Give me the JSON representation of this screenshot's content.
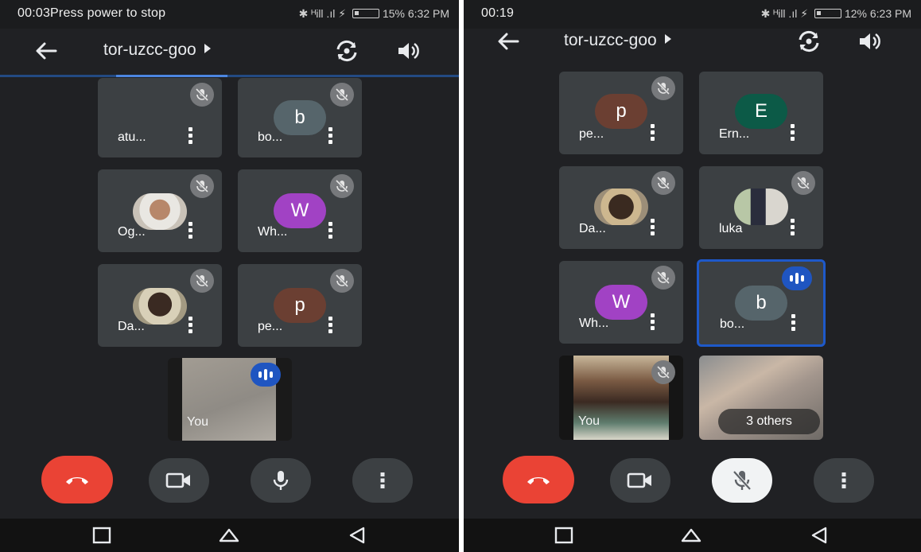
{
  "left": {
    "status": {
      "timer": "00:03",
      "message": "Press power to stop",
      "signal": "✱ ᴴill .ıl ⚡",
      "battery": "15%",
      "time": "6:32 PM"
    },
    "meeting_title": "tor-uzcc-goo",
    "tiles": [
      {
        "name": "atu...",
        "avatar_letter": "",
        "muted": true
      },
      {
        "name": "bo...",
        "avatar_letter": "b",
        "avatar_color": "#56656b",
        "muted": true
      },
      {
        "name": "Og...",
        "avatar_letter": "",
        "photo": "photo-avatar",
        "muted": true
      },
      {
        "name": "Wh...",
        "avatar_letter": "W",
        "avatar_color": "#a142c4",
        "muted": true
      },
      {
        "name": "Da...",
        "avatar_letter": "",
        "photo": "photo-avatar",
        "muted": true
      },
      {
        "name": "pe...",
        "avatar_letter": "p",
        "avatar_color": "#6b3f32",
        "muted": true
      }
    ],
    "self_tile": {
      "label": "You",
      "speaking": true
    }
  },
  "right": {
    "status": {
      "timer": "00:19",
      "signal": "✱ ᴴill .ıl ⚡",
      "battery": "12%",
      "time": "6:23 PM"
    },
    "meeting_title": "tor-uzcc-goo",
    "tiles": [
      {
        "name": "pe...",
        "avatar_letter": "p",
        "avatar_color": "#6b3f32",
        "muted": true
      },
      {
        "name": "Ern...",
        "avatar_letter": "E",
        "avatar_color": "#0c5a47",
        "muted": false
      },
      {
        "name": "Da...",
        "avatar_letter": "",
        "photo": "photo-avatar",
        "muted": true
      },
      {
        "name": "luka",
        "avatar_letter": "",
        "photo": "photo-avatar",
        "muted": true
      },
      {
        "name": "Wh...",
        "avatar_letter": "W",
        "avatar_color": "#a142c4",
        "muted": true
      },
      {
        "name": "bo...",
        "avatar_letter": "b",
        "avatar_color": "#56656b",
        "speaking": true
      }
    ],
    "self_tile": {
      "label": "You",
      "muted": true
    },
    "others_tile": {
      "label": "3 others"
    }
  },
  "colors": {
    "background": "#202124",
    "tile": "#3c4043",
    "end_call": "#ea4335",
    "speaking": "#1e59c9"
  },
  "icons": [
    "back-arrow-icon",
    "flip-camera-icon",
    "speaker-icon",
    "mic-off-icon",
    "speaking-indicator-icon",
    "more-vert-icon",
    "end-call-icon",
    "camera-icon",
    "mic-icon",
    "nav-recents-icon",
    "nav-home-icon",
    "nav-back-icon"
  ]
}
